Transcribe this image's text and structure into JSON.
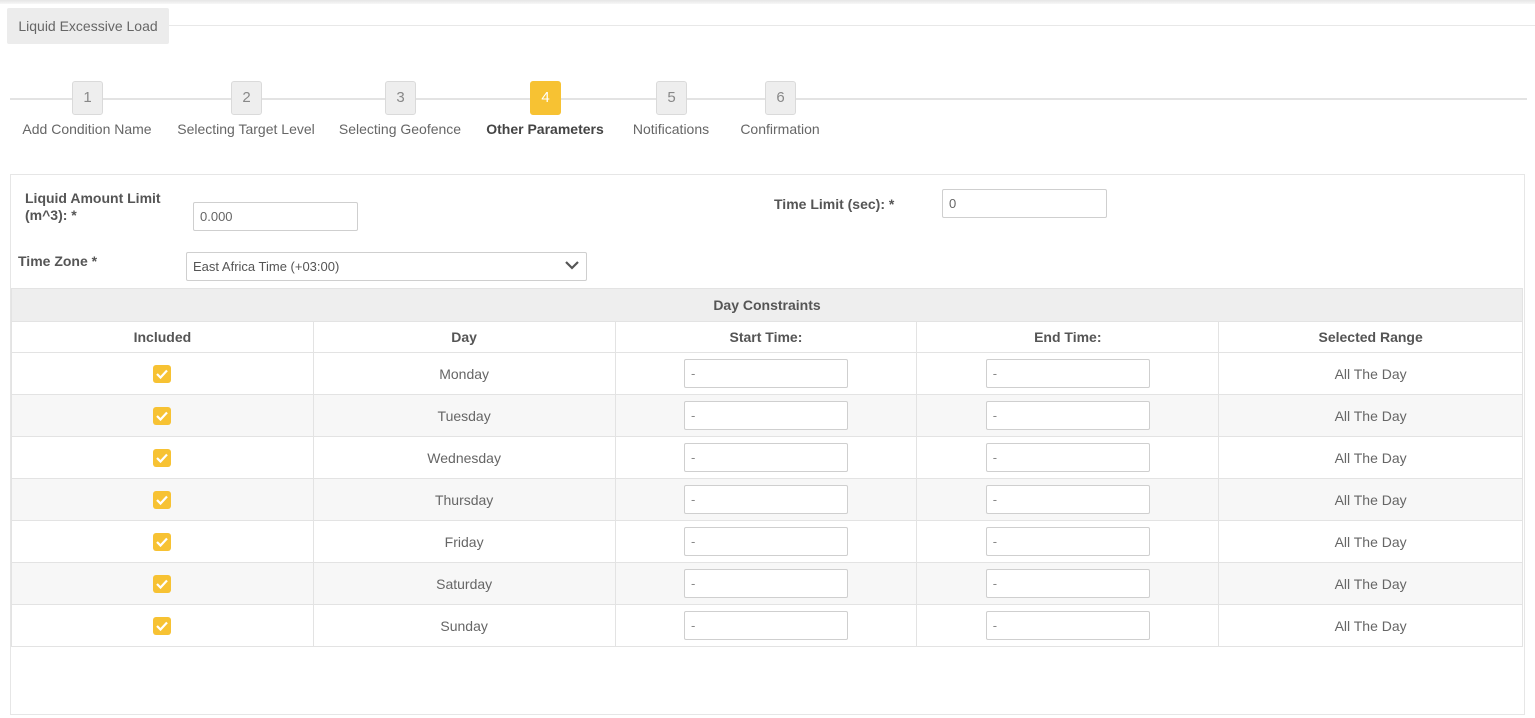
{
  "tab": {
    "label": "Liquid Excessive Load"
  },
  "wizard": {
    "steps": [
      {
        "num": "1",
        "label": "Add Condition Name"
      },
      {
        "num": "2",
        "label": "Selecting Target Level"
      },
      {
        "num": "3",
        "label": "Selecting Geofence"
      },
      {
        "num": "4",
        "label": "Other Parameters"
      },
      {
        "num": "5",
        "label": "Notifications"
      },
      {
        "num": "6",
        "label": "Confirmation"
      }
    ],
    "active_step": 4
  },
  "form": {
    "liquid_limit_label_line1": "Liquid Amount Limit",
    "liquid_limit_label_line2": "(m^3):  *",
    "liquid_limit_value": "0.000",
    "time_limit_label": "Time Limit (sec):  *",
    "time_limit_value": "0",
    "time_zone_label": "Time Zone  *",
    "time_zone_value": "East Africa Time (+03:00)"
  },
  "day_constraints": {
    "caption": "Day Constraints",
    "headers": [
      "Included",
      "Day",
      "Start Time:",
      "End Time:",
      "Selected Range"
    ],
    "rows": [
      {
        "day": "Monday",
        "included": true,
        "start": "-",
        "end": "-",
        "range": "All The Day"
      },
      {
        "day": "Tuesday",
        "included": true,
        "start": "-",
        "end": "-",
        "range": "All The Day"
      },
      {
        "day": "Wednesday",
        "included": true,
        "start": "-",
        "end": "-",
        "range": "All The Day"
      },
      {
        "day": "Thursday",
        "included": true,
        "start": "-",
        "end": "-",
        "range": "All The Day"
      },
      {
        "day": "Friday",
        "included": true,
        "start": "-",
        "end": "-",
        "range": "All The Day"
      },
      {
        "day": "Saturday",
        "included": true,
        "start": "-",
        "end": "-",
        "range": "All The Day"
      },
      {
        "day": "Sunday",
        "included": true,
        "start": "-",
        "end": "-",
        "range": "All The Day"
      }
    ]
  },
  "colors": {
    "accent": "#f7c233",
    "header_bg": "#eeeeee",
    "border": "#e3e3e3"
  },
  "icons": {
    "checkbox": "checkmark-icon",
    "dropdown": "chevron-down-icon"
  }
}
